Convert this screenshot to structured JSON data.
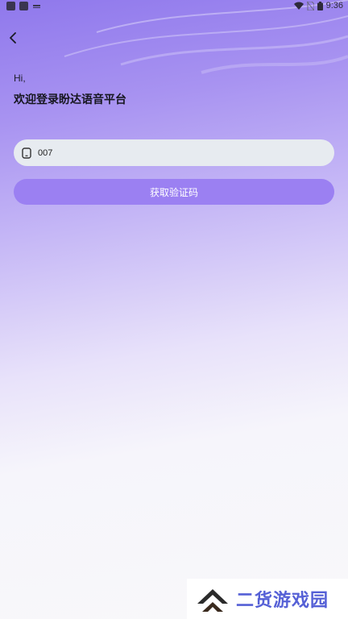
{
  "status_bar": {
    "time": "9:36"
  },
  "nav": {
    "back_icon": "chevron-left-icon"
  },
  "greeting": {
    "hi": "Hi,",
    "title": "欢迎登录盼达语音平台"
  },
  "phone_input": {
    "value": "007",
    "icon": "phone-icon"
  },
  "get_code_button": {
    "label": "获取验证码"
  },
  "watermark": {
    "text": "二货游戏园"
  },
  "colors": {
    "accent": "#9b80f2",
    "input_bg": "#e7ebf0",
    "watermark_text": "#5560d6"
  }
}
